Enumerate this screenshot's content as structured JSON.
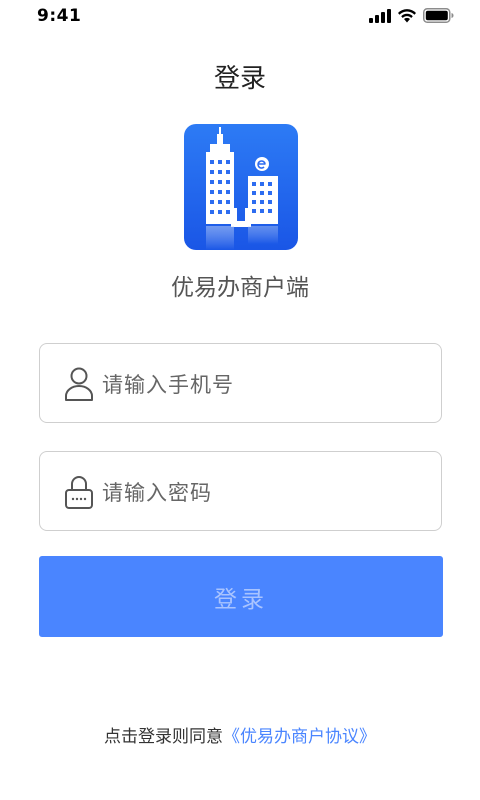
{
  "status_bar": {
    "time": "9:41"
  },
  "header": {
    "title": "登录"
  },
  "app": {
    "logo": "building-logo",
    "name": "优易办商户端"
  },
  "form": {
    "phone_placeholder": "请输入手机号",
    "password_placeholder": "请输入密码",
    "submit_label": "登录"
  },
  "agreement": {
    "prefix": "点击登录则同意",
    "link": "《优易办商户协议》"
  },
  "icons": {
    "user": "user-icon",
    "lock": "lock-icon"
  },
  "colors": {
    "primary": "#4a85ff",
    "logo_gradient_top": "#2d7bf5",
    "logo_gradient_bottom": "#1a56e6",
    "button_text": "#a9c4ff"
  }
}
